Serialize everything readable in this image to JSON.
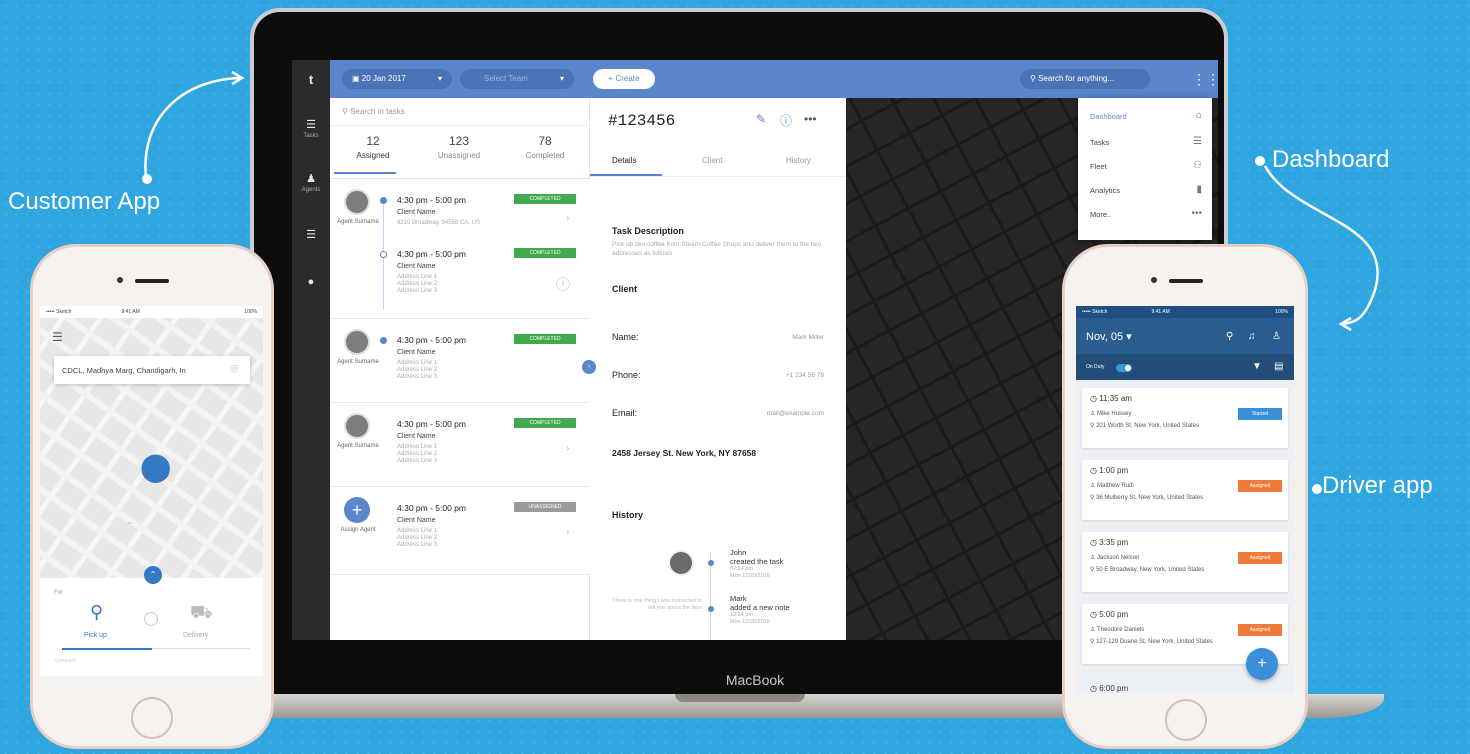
{
  "callouts": {
    "customer": "Customer App",
    "dashboard": "Dashboard",
    "driver": "Driver app"
  },
  "laptop": {
    "brand": "MacBook"
  },
  "dashboard": {
    "sidebar": [
      {
        "icon": "logo-t-icon",
        "glyph": "t",
        "label": ""
      },
      {
        "icon": "list-icon",
        "glyph": "☰",
        "label": "Tasks"
      },
      {
        "icon": "agents-icon",
        "glyph": "♟",
        "label": "Agents"
      },
      {
        "icon": "menu-icon",
        "glyph": "☰",
        "label": ""
      },
      {
        "icon": "user-icon",
        "glyph": "●",
        "label": ""
      }
    ],
    "topbar": {
      "date": "20 Jan 2017",
      "team_placeholder": "Select Team",
      "create_label": "+ Create",
      "search_placeholder": "Search for anything..."
    },
    "tasks": {
      "search_placeholder": "Search in tasks",
      "counts": [
        {
          "value": "12",
          "label": "Assigned"
        },
        {
          "value": "123",
          "label": "Unassigned"
        },
        {
          "value": "78",
          "label": "Completed"
        }
      ],
      "cards": [
        {
          "agent": "Agent Surname",
          "stops": [
            {
              "time": "4:30 pm - 5:00 pm",
              "name": "Client Name",
              "address": "8210 Broadway, 94568 CA, US",
              "badge": "COMPLETED"
            },
            {
              "time": "4:30 pm - 5:00 pm",
              "name": "Client Name",
              "address": "Address Line 1\nAddress Line 2\nAddress Line 3",
              "badge": "COMPLETED"
            }
          ]
        },
        {
          "agent": "Agent Surname",
          "time": "4:30 pm - 5:00 pm",
          "name": "Client Name",
          "address": "Address Line 1\nAddress Line 2\nAddress Line 3",
          "badge": "COMPLETED"
        },
        {
          "agent": "Agent Surname",
          "time": "4:30 pm - 5:00 pm",
          "name": "Client Name",
          "address": "Address Line 1\nAddress Line 2\nAddress Line 3",
          "badge": "COMPLETED"
        },
        {
          "agent": "Assign Agent",
          "time": "4:30 pm - 5:00 pm",
          "name": "Client Name",
          "address": "Address Line 1\nAddress Line 2\nAddress Line 3",
          "badge": "UNASSIGNED"
        }
      ]
    },
    "detail": {
      "task_id": "#123456",
      "tabs": [
        "Details",
        "Client",
        "History"
      ],
      "description_title": "Task Description",
      "description": "Pick up two coffee from Steam Coffee Shops and deliver them to the two addresses as follows",
      "client_title": "Client",
      "name_label": "Name:",
      "name_value": "Mark Miller",
      "phone_label": "Phone:",
      "phone_value": "+1 234 56 78",
      "email_label": "Email:",
      "email_value": "mail@example.com",
      "address": "2458 Jersey St. New York, NY 87658",
      "history_title": "History",
      "history": [
        {
          "who": "John",
          "action": "created the task",
          "when": "02:24 pm\nMon 12/20/2016"
        },
        {
          "who": "Mark",
          "action": "added a new note",
          "when": "12:24 pm\nMon 12/20/2016"
        }
      ],
      "history_note": "There is one thing I was instructed to tell you about the item"
    },
    "menu": [
      {
        "label": "Dashboard",
        "icon": "home-icon",
        "glyph": "⌂",
        "active": true
      },
      {
        "label": "Tasks",
        "icon": "list-icon",
        "glyph": "☰",
        "active": false
      },
      {
        "label": "Fleet",
        "icon": "fleet-icon",
        "glyph": "⚇",
        "active": false
      },
      {
        "label": "Analytics",
        "icon": "analytics-icon",
        "glyph": "▮",
        "active": false
      },
      {
        "label": "More..",
        "icon": "more-icon",
        "glyph": "•••",
        "active": false
      }
    ]
  },
  "customer_app": {
    "status_carrier": "••••• Sketch",
    "status_time": "9:41 AM",
    "status_battery": "100%",
    "location": "CDCL, Madhya Marg, Chandigarh, In",
    "for_label": "For",
    "pickup_label": "Pick up",
    "delivery_label": "Delivery",
    "comment_placeholder": "Comment"
  },
  "driver_app": {
    "status_carrier": "••••• Sketch",
    "status_time": "9:41 AM",
    "status_battery": "100%",
    "date": "Nov, 05 ▾",
    "on_duty": "On Duty",
    "tasks": [
      {
        "time": "11:35 am",
        "name": "Mike Hussey",
        "address": "201 Worth St, New York, United States",
        "status": "Started",
        "color": "#3a8fd8"
      },
      {
        "time": "1:00 pm",
        "name": "Matthew Rudi",
        "address": "36 Mulberry St, New York, United States",
        "status": "Assigned",
        "color": "#f07a3a"
      },
      {
        "time": "3:35 pm",
        "name": "Jackson Nelson",
        "address": "50 E Broadway, New York, United States",
        "status": "Assigned",
        "color": "#f07a3a"
      },
      {
        "time": "5:00 pm",
        "name": "Theodore Daniels",
        "address": "127-129 Duane St, New York, United States",
        "status": "Assigned",
        "color": "#f07a3a"
      }
    ],
    "next_time": "6:00 pm"
  }
}
